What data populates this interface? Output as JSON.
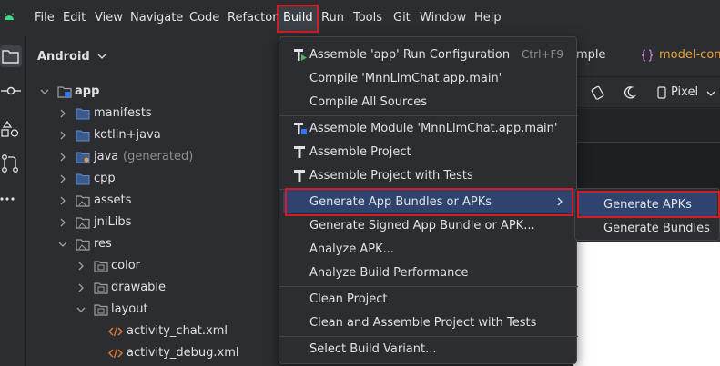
{
  "menubar": {
    "items": [
      "File",
      "Edit",
      "View",
      "Navigate",
      "Code",
      "Refactor",
      "Build",
      "Run",
      "Tools",
      "Git",
      "Window",
      "Help"
    ],
    "active": "Build"
  },
  "project_panel": {
    "title": "Android",
    "tree": [
      {
        "label": "app",
        "type": "module",
        "expanded": true
      },
      {
        "label": "manifests",
        "type": "folder"
      },
      {
        "label": "kotlin+java",
        "type": "folder"
      },
      {
        "label": "java",
        "suffix": "(generated)",
        "type": "folder-generated"
      },
      {
        "label": "cpp",
        "type": "folder"
      },
      {
        "label": "assets",
        "type": "folder-res"
      },
      {
        "label": "jniLibs",
        "type": "folder-res"
      },
      {
        "label": "res",
        "type": "folder-res",
        "expanded": true
      },
      {
        "label": "color",
        "type": "folder-res"
      },
      {
        "label": "drawable",
        "type": "folder-res"
      },
      {
        "label": "layout",
        "type": "folder-res",
        "expanded": true
      },
      {
        "label": "activity_chat.xml",
        "type": "xml"
      },
      {
        "label": "activity_debug.xml",
        "type": "xml"
      }
    ]
  },
  "editor": {
    "tabs": [
      "mple",
      "model-conf"
    ],
    "toolbar": {
      "device": "Pixel"
    }
  },
  "build_menu": {
    "items": [
      {
        "label": "Assemble 'app' Run Configuration",
        "shortcut": "Ctrl+F9",
        "icon": "assemble-run-icon"
      },
      {
        "label": "Compile 'MnnLlmChat.app.main'"
      },
      {
        "label": "Compile All Sources"
      },
      {
        "label": "Assemble Module 'MnnLlmChat.app.main'",
        "icon": "assemble-module-icon"
      },
      {
        "label": "Assemble Project",
        "icon": "hammer-icon"
      },
      {
        "label": "Assemble Project with Tests",
        "icon": "hammer-icon"
      },
      {
        "label": "Generate App Bundles or APKs",
        "has_submenu": true,
        "selected": true
      },
      {
        "label": "Generate Signed App Bundle or APK..."
      },
      {
        "label": "Analyze APK..."
      },
      {
        "label": "Analyze Build Performance"
      },
      {
        "label": "Clean Project"
      },
      {
        "label": "Clean and Assemble Project with Tests"
      },
      {
        "label": "Select Build Variant..."
      }
    ]
  },
  "submenu": {
    "items": [
      {
        "label": "Generate APKs",
        "selected": true
      },
      {
        "label": "Generate Bundles"
      }
    ]
  },
  "colors": {
    "background": "#2b2d30",
    "selection": "#2e436e",
    "highlight_box": "#d51b24",
    "accent_blue": "#3574f0",
    "config_orange": "#e8a33d"
  }
}
